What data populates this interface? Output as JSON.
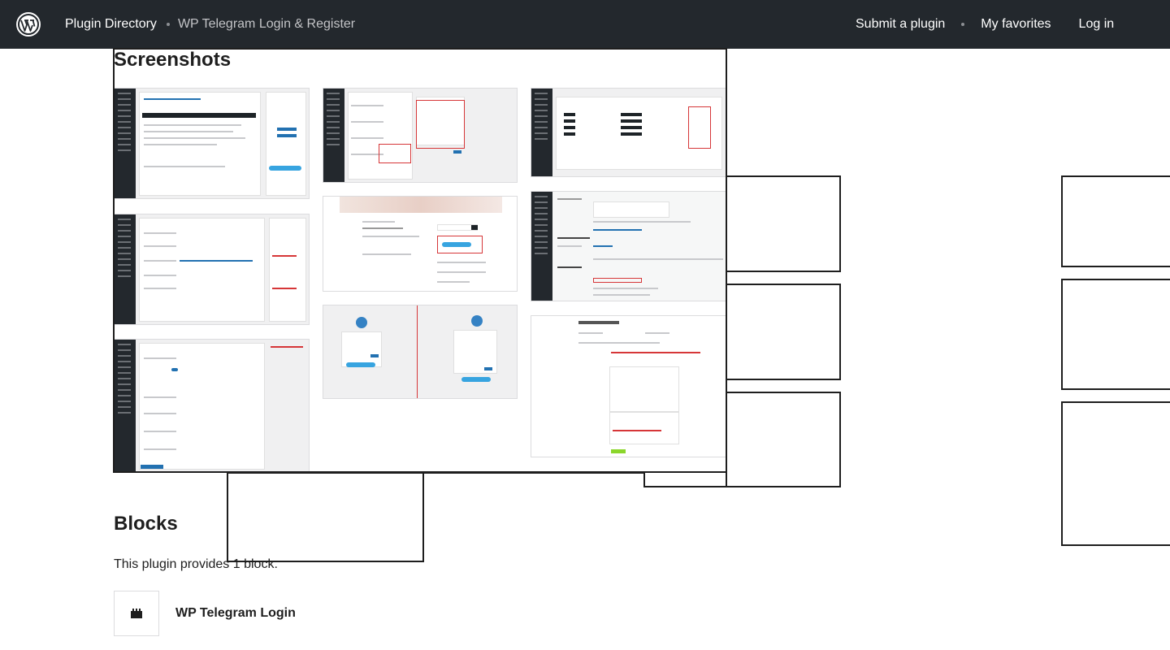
{
  "header": {
    "logo_icon": "wordpress-logo-icon",
    "breadcrumb": [
      "Plugin Directory",
      "WP Telegram Login & Register"
    ],
    "nav": [
      "Submit a plugin",
      "My favorites",
      "Log in"
    ]
  },
  "screenshots": {
    "title": "Screenshots",
    "count": 9
  },
  "blocks": {
    "title": "Blocks",
    "description": "This plugin provides 1 block.",
    "items": [
      {
        "name": "WP Telegram Login",
        "icon": "block-icon"
      }
    ]
  },
  "colors": {
    "topbar": "#23282d",
    "accent": "#2271b1",
    "telegram": "#37a4e0",
    "highlight": "#d63638"
  }
}
